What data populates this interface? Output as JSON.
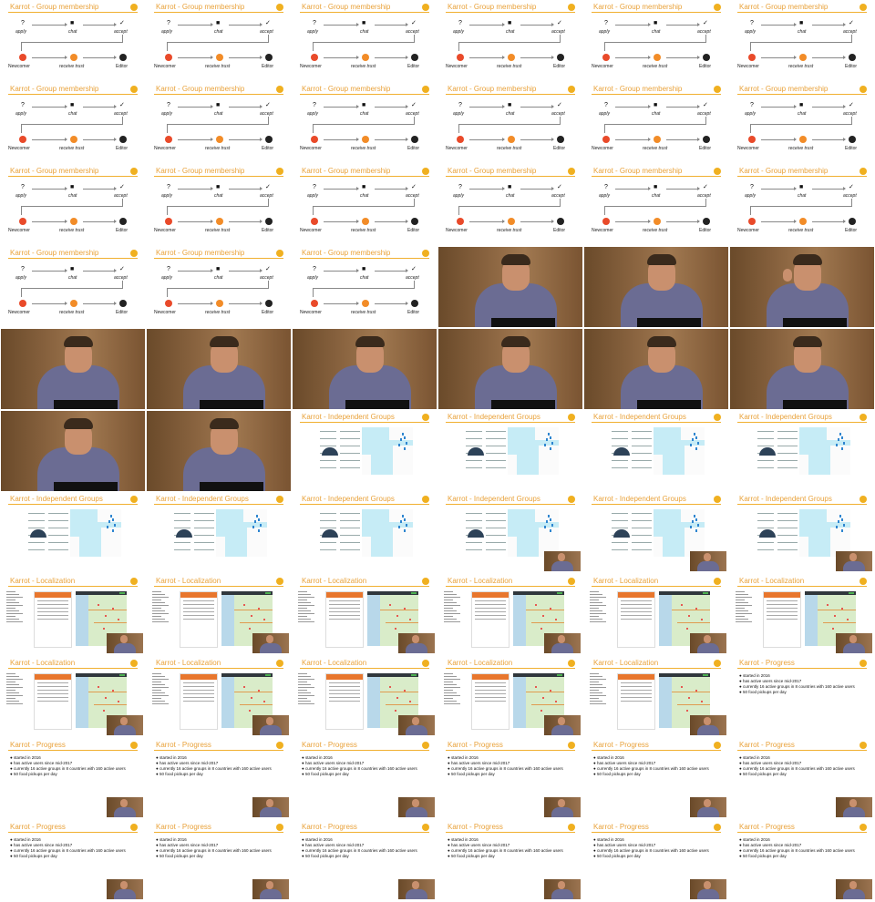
{
  "slides": {
    "group_membership": {
      "title": "Karrot - Group membership",
      "labels": {
        "apply": "apply",
        "chat": "chat",
        "accept": "accept",
        "newcomer": "Newcomer",
        "receive_trust": "receive trust",
        "editor": "Editor"
      },
      "icons": {
        "apply": "question-mark-icon",
        "chat": "chat-bubble-icon",
        "accept": "checkmark-icon",
        "newcomer": "newcomer-badge-icon",
        "trust": "trust-badge-icon",
        "editor": "editor-badge-icon"
      }
    },
    "independent_groups": {
      "title": "Karrot - Independent Groups"
    },
    "localization": {
      "title": "Karrot - Localization"
    },
    "progress": {
      "title": "Karrot - Progress",
      "bullets": [
        "started in 2016",
        "has active users since mid-2017",
        "currently 16 active groups in 8 countries with 160 active users",
        "50 food pickups per day"
      ]
    }
  },
  "colors": {
    "accent": "#f0b030",
    "hoodie": "#6b6c93",
    "map_sea": "#c6ecf6",
    "pin": "#2f86d0",
    "panel_bar": "#e8762d"
  },
  "tiles": [
    "group_membership",
    "group_membership",
    "group_membership",
    "group_membership",
    "group_membership",
    "group_membership",
    "group_membership",
    "group_membership",
    "group_membership",
    "group_membership",
    "group_membership",
    "group_membership",
    "group_membership",
    "group_membership",
    "group_membership",
    "group_membership",
    "group_membership",
    "group_membership",
    "group_membership",
    "group_membership",
    "group_membership",
    "speaker",
    "speaker",
    "speaker_wave",
    "speaker",
    "speaker",
    "speaker",
    "speaker",
    "speaker",
    "speaker",
    "speaker",
    "speaker",
    "independent_groups",
    "independent_groups",
    "independent_groups",
    "independent_groups",
    "independent_groups",
    "independent_groups",
    "independent_groups",
    "independent_groups_inset",
    "independent_groups_inset",
    "independent_groups_inset",
    "localization",
    "localization",
    "localization",
    "localization",
    "localization",
    "localization",
    "localization",
    "localization",
    "localization",
    "localization",
    "localization",
    "progress",
    "progress",
    "progress",
    "progress",
    "progress",
    "progress",
    "progress",
    "progress",
    "progress",
    "progress",
    "progress",
    "progress",
    "progress"
  ]
}
